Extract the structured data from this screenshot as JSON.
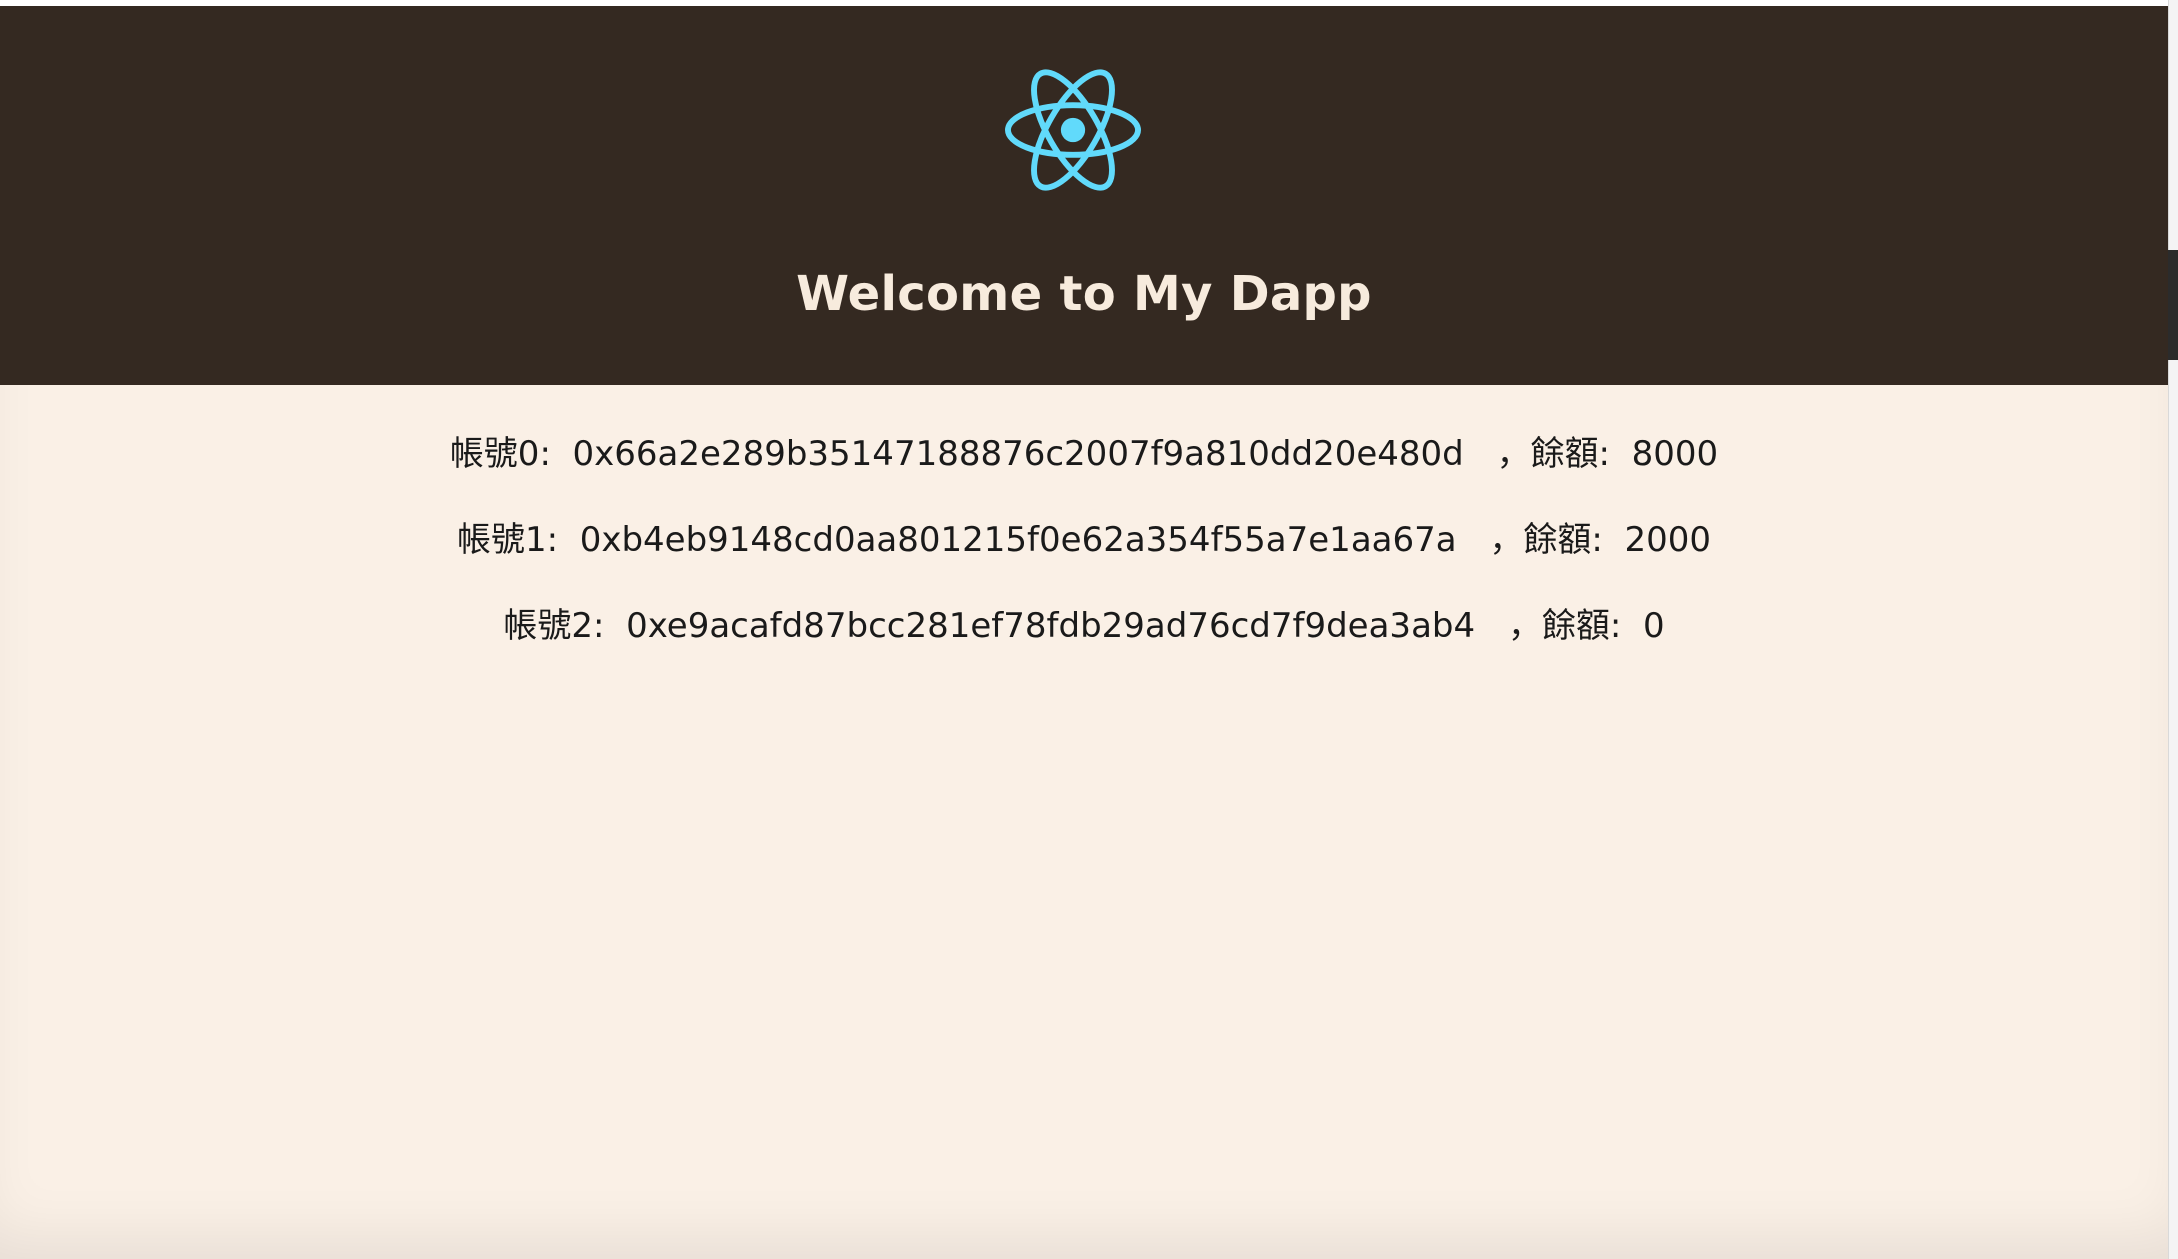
{
  "header": {
    "logo_icon": "react-atom-icon",
    "logo_color": "#61dafb",
    "title": "Welcome to My Dapp",
    "background": "#342921"
  },
  "accounts": [
    {
      "label": "帳號0:",
      "address": "0x66a2e289b35147188876c2007f9a810dd20e480d",
      "balance_label": "，餘額:",
      "balance": "8000"
    },
    {
      "label": "帳號1:",
      "address": "0xb4eb9148cd0aa801215f0e62a354f55a7e1aa67a",
      "balance_label": "，餘額:",
      "balance": "2000"
    },
    {
      "label": "帳號2:",
      "address": "0xe9acafd87bcc281ef78fdb29ad76cd7f9dea3ab4",
      "balance_label": "，餘額:",
      "balance": "0"
    }
  ],
  "colors": {
    "page_background": "#faf0e6",
    "header_text": "#f7ebdd"
  }
}
